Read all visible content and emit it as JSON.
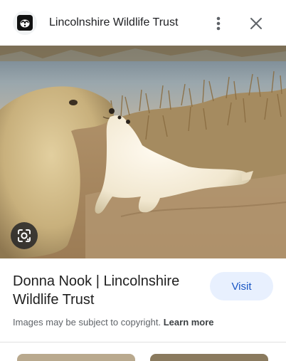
{
  "header": {
    "site_name": "Lincolnshire Wildlife Trust",
    "logo_icon": "badger-logo-icon",
    "menu_icon": "more-vert-icon",
    "close_icon": "close-icon"
  },
  "image": {
    "subject": "grey-seal-with-pup-photo",
    "lens_icon": "google-lens-icon"
  },
  "result": {
    "title": "Donna Nook | Lincolnshire Wildlife Trust",
    "visit_label": "Visit"
  },
  "footer": {
    "copyright_text": "Images may be subject to copyright.",
    "learn_more_label": "Learn more"
  },
  "colors": {
    "visit_bg": "#e8f0fe",
    "visit_text": "#1a56c4",
    "secondary_text": "#5f6368"
  }
}
